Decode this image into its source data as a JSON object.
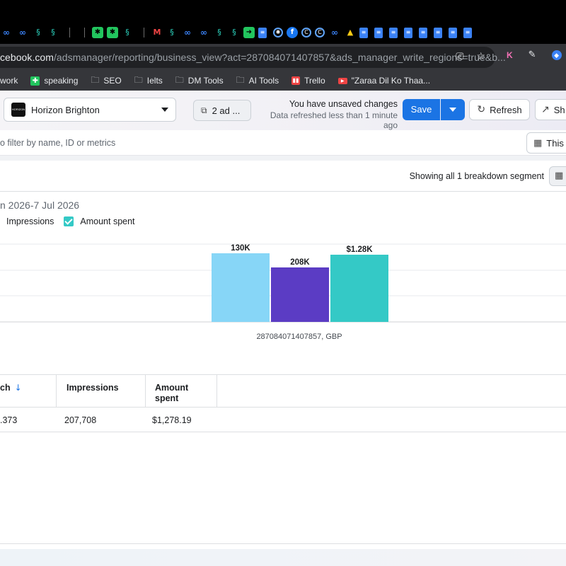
{
  "browser": {
    "url_host": "cebook.com",
    "url_rest": "/adsmanager/reporting/business_view?act=287084071407857&ads_manager_write_regions=true&b...",
    "bookmarks": [
      {
        "label": "work",
        "icon": "none-icon"
      },
      {
        "label": "speaking",
        "icon": "green-plus-icon"
      },
      {
        "label": "SEO",
        "icon": "folder-icon"
      },
      {
        "label": "Ielts",
        "icon": "folder-icon"
      },
      {
        "label": "DM Tools",
        "icon": "folder-icon"
      },
      {
        "label": "AI Tools",
        "icon": "folder-icon"
      },
      {
        "label": "Trello",
        "icon": "trello-icon"
      },
      {
        "label": "\"Zaraa Dil Ko Thaa...",
        "icon": "youtube-icon"
      }
    ]
  },
  "toolbar": {
    "account_name": "Horizon Brighton",
    "ad_selector_label": "2 ad ...",
    "unsaved_title": "You have unsaved changes",
    "unsaved_subtitle": "Data refreshed less than 1 minute ago",
    "save_label": "Save",
    "refresh_label": "Refresh",
    "share_label": "Sh"
  },
  "filter": {
    "placeholder": "o filter by name, ID or metrics",
    "view_label": "This"
  },
  "breakdown": {
    "text": "Showing all 1 breakdown segment"
  },
  "chart_data": {
    "type": "bar",
    "date_range": "n 2026-7 Jul 2026",
    "legend": [
      {
        "label": "Impressions",
        "checked": true,
        "color": "#5b3cc4"
      },
      {
        "label": "Amount spent",
        "checked": true,
        "color": "#34c9c6"
      }
    ],
    "categories": [
      "287084071407857, GBP"
    ],
    "series": [
      {
        "values_label": "130K",
        "value": 130373,
        "color": "#87d6f7"
      },
      {
        "name": "Impressions",
        "values_label": "208K",
        "value": 207708,
        "color": "#5b3cc4"
      },
      {
        "name": "Amount spent",
        "values_label": "$1.28K",
        "value": 1278.19,
        "color": "#34c9c6"
      }
    ],
    "grid": true
  },
  "table": {
    "columns": [
      {
        "label": "ch",
        "sorted": true
      },
      {
        "label": "Impressions"
      },
      {
        "label": "Amount spent"
      }
    ],
    "rows": [
      [
        ".373",
        "207,708",
        "$1,278.19"
      ]
    ]
  }
}
